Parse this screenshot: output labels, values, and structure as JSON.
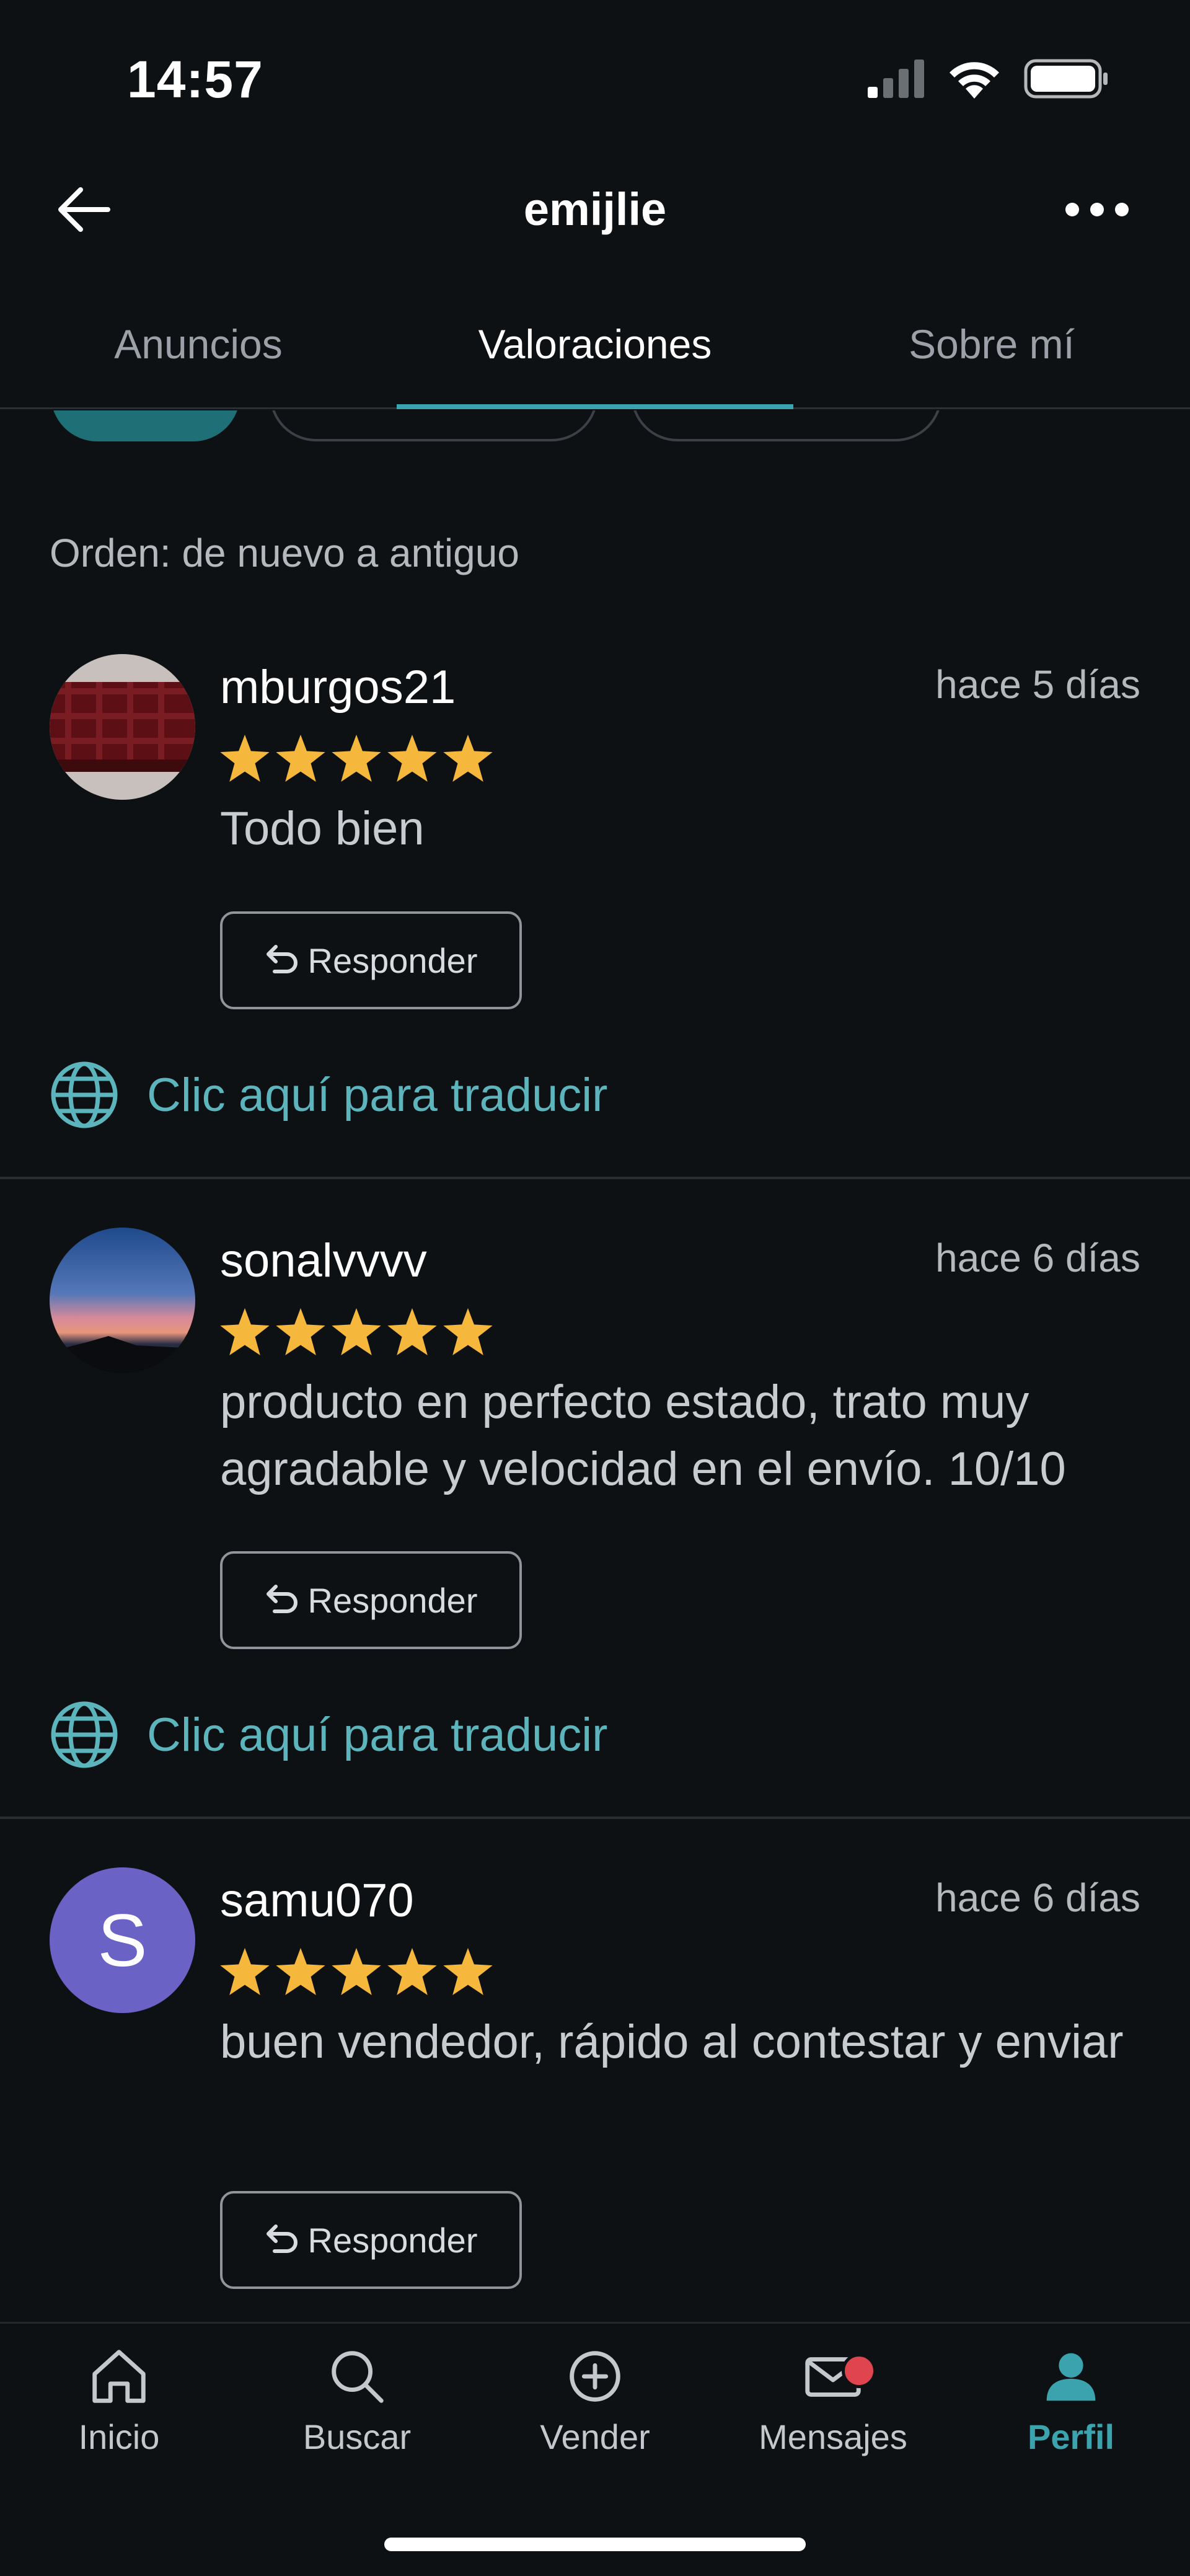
{
  "status_bar": {
    "time": "14:57",
    "icons": [
      "signal-icon",
      "wifi-icon",
      "battery-icon"
    ]
  },
  "header": {
    "title": "emijlie",
    "back_icon": "arrow-left-icon",
    "more_icon": "more-horizontal-icon"
  },
  "tabs": [
    {
      "label": "Anuncios",
      "active": false
    },
    {
      "label": "Valoraciones",
      "active": true
    },
    {
      "label": "Sobre mí",
      "active": false
    }
  ],
  "order_label": "Orden: de nuevo a antiguo",
  "reviews": [
    {
      "user": "mburgos21",
      "date": "hace 5 días",
      "rating": 5,
      "text": "Todo bien",
      "reply_label": "Responder",
      "translate_label": "Clic aquí para traducir",
      "avatar": "photo"
    },
    {
      "user": "sonalvvvv",
      "date": "hace 6 días",
      "rating": 5,
      "text": "producto en perfecto estado, trato muy agradable y velocidad en el envío. 10/10",
      "reply_label": "Responder",
      "translate_label": "Clic aquí para traducir",
      "avatar": "photo"
    },
    {
      "user": "samu070",
      "date": "hace 6 días",
      "rating": 5,
      "text": "buen vendedor, rápido al contestar y enviar",
      "reply_label": "Responder",
      "avatar_letter": "S"
    }
  ],
  "bottom_nav": [
    {
      "label": "Inicio",
      "icon": "home-icon",
      "active": false
    },
    {
      "label": "Buscar",
      "icon": "search-icon",
      "active": false
    },
    {
      "label": "Vender",
      "icon": "plus-circle-icon",
      "active": false
    },
    {
      "label": "Mensajes",
      "icon": "mail-icon",
      "active": false,
      "badge": true
    },
    {
      "label": "Perfil",
      "icon": "profile-icon",
      "active": true
    }
  ],
  "colors": {
    "background": "#0e1114",
    "accent": "#3aa3ad",
    "link": "#5cb4bd",
    "star": "#f5b83d",
    "avatar_purple": "#6a62c4",
    "badge": "#e0454f"
  }
}
